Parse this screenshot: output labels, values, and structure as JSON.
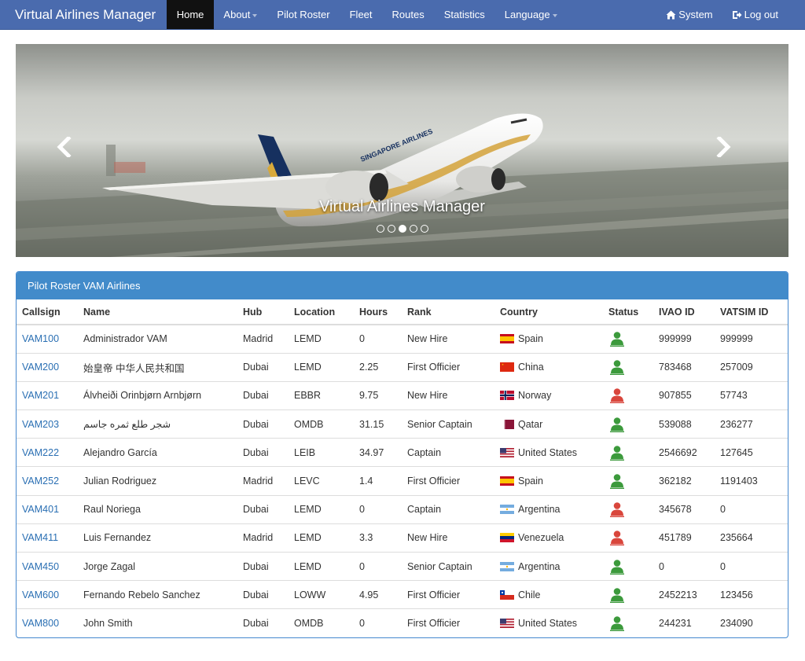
{
  "navbar": {
    "brand": "Virtual Airlines Manager",
    "items": [
      {
        "label": "Home",
        "active": true
      },
      {
        "label": "About",
        "dropdown": true
      },
      {
        "label": "Pilot Roster"
      },
      {
        "label": "Fleet"
      },
      {
        "label": "Routes"
      },
      {
        "label": "Statistics"
      },
      {
        "label": "Language",
        "dropdown": true
      }
    ],
    "right": {
      "system_label": "System",
      "system_icon": "home-icon",
      "logout_label": "Log out",
      "logout_icon": "logout-icon"
    },
    "color": "#4a6bae"
  },
  "carousel": {
    "caption": "Virtual Airlines Manager",
    "slide_count": 5,
    "active_slide": 3,
    "prev_icon": "chevron-left-icon",
    "next_icon": "chevron-right-icon",
    "aircraft_livery_text": "SINGAPORE AIRLINES"
  },
  "roster": {
    "title": "Pilot Roster VAM Airlines",
    "heading_color": "#428bca",
    "columns": [
      "Callsign",
      "Name",
      "Hub",
      "Location",
      "Hours",
      "Rank",
      "Country",
      "Status",
      "IVAO ID",
      "VATSIM ID"
    ],
    "rows": [
      {
        "callsign": "VAM100",
        "name": "Administrador VAM",
        "hub": "Madrid",
        "location": "LEMD",
        "hours": "0",
        "rank": "New Hire",
        "country": "Spain",
        "flag": "es",
        "status": "active",
        "ivao": "999999",
        "vatsim": "999999"
      },
      {
        "callsign": "VAM200",
        "name": "始皇帝 中华人民共和国",
        "hub": "Dubai",
        "location": "LEMD",
        "hours": "2.25",
        "rank": "First Officier",
        "country": "China",
        "flag": "cn",
        "status": "active",
        "ivao": "783468",
        "vatsim": "257009"
      },
      {
        "callsign": "VAM201",
        "name": "Álvheiði Orinbjørn Arnbjørn",
        "hub": "Dubai",
        "location": "EBBR",
        "hours": "9.75",
        "rank": "New Hire",
        "country": "Norway",
        "flag": "no",
        "status": "inactive",
        "ivao": "907855",
        "vatsim": "57743"
      },
      {
        "callsign": "VAM203",
        "name": "شجر طلع ثمره جاسم",
        "hub": "Dubai",
        "location": "OMDB",
        "hours": "31.15",
        "rank": "Senior Captain",
        "country": "Qatar",
        "flag": "qa",
        "status": "active",
        "ivao": "539088",
        "vatsim": "236277"
      },
      {
        "callsign": "VAM222",
        "name": "Alejandro García",
        "hub": "Dubai",
        "location": "LEIB",
        "hours": "34.97",
        "rank": "Captain",
        "country": "United States",
        "flag": "us",
        "status": "active",
        "ivao": "2546692",
        "vatsim": "127645"
      },
      {
        "callsign": "VAM252",
        "name": "Julian Rodriguez",
        "hub": "Madrid",
        "location": "LEVC",
        "hours": "1.4",
        "rank": "First Officier",
        "country": "Spain",
        "flag": "es",
        "status": "active",
        "ivao": "362182",
        "vatsim": "1191403"
      },
      {
        "callsign": "VAM401",
        "name": "Raul Noriega",
        "hub": "Dubai",
        "location": "LEMD",
        "hours": "0",
        "rank": "Captain",
        "country": "Argentina",
        "flag": "ar",
        "status": "inactive",
        "ivao": "345678",
        "vatsim": "0"
      },
      {
        "callsign": "VAM411",
        "name": "Luis Fernandez",
        "hub": "Madrid",
        "location": "LEMD",
        "hours": "3.3",
        "rank": "New Hire",
        "country": "Venezuela",
        "flag": "ve",
        "status": "inactive",
        "ivao": "451789",
        "vatsim": "235664"
      },
      {
        "callsign": "VAM450",
        "name": "Jorge Zagal",
        "hub": "Dubai",
        "location": "LEMD",
        "hours": "0",
        "rank": "Senior Captain",
        "country": "Argentina",
        "flag": "ar",
        "status": "active",
        "ivao": "0",
        "vatsim": "0"
      },
      {
        "callsign": "VAM600",
        "name": "Fernando Rebelo Sanchez",
        "hub": "Dubai",
        "location": "LOWW",
        "hours": "4.95",
        "rank": "First Officier",
        "country": "Chile",
        "flag": "cl",
        "status": "active",
        "ivao": "2452213",
        "vatsim": "123456"
      },
      {
        "callsign": "VAM800",
        "name": "John Smith",
        "hub": "Dubai",
        "location": "OMDB",
        "hours": "0",
        "rank": "First Officier",
        "country": "United States",
        "flag": "us",
        "status": "active",
        "ivao": "244231",
        "vatsim": "234090"
      }
    ],
    "status_colors": {
      "active": "#3c9a3c",
      "inactive": "#d9463c"
    },
    "link_color": "#2a6fb3"
  }
}
